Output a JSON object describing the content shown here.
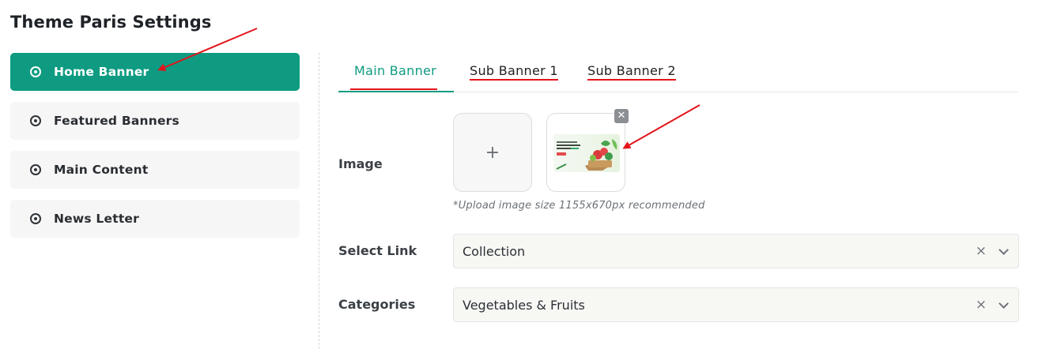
{
  "page": {
    "title": "Theme Paris Settings"
  },
  "sidebar": {
    "items": [
      {
        "label": "Home Banner",
        "active": true
      },
      {
        "label": "Featured Banners",
        "active": false
      },
      {
        "label": "Main Content",
        "active": false
      },
      {
        "label": "News Letter",
        "active": false
      }
    ]
  },
  "tabs": [
    {
      "label": "Main Banner",
      "active": true
    },
    {
      "label": "Sub Banner 1",
      "active": false
    },
    {
      "label": "Sub Banner 2",
      "active": false
    }
  ],
  "form": {
    "image_label": "Image",
    "upload_symbol": "+",
    "thumbnail_close": "✕",
    "upload_hint": "*Upload image size 1155x670px recommended",
    "link_label": "Select Link",
    "link_value": "Collection",
    "categories_label": "Categories",
    "categories_value": "Vegetables & Fruits",
    "clear_symbol": "×"
  },
  "colors": {
    "accent": "#0e9b81",
    "annotation": "#e3141b"
  },
  "icons": {
    "sidebar_item": "radio-dot-icon",
    "select_clear": "clear-icon",
    "select_open": "chevron-down-icon"
  }
}
